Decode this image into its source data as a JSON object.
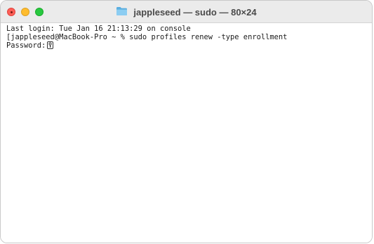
{
  "window": {
    "title": "jappleseed — sudo — 80×24",
    "title_icon": "folder-icon",
    "controls": [
      "close-button",
      "minimize-button",
      "zoom-button"
    ]
  },
  "terminal": {
    "lines": [
      "Last login: Tue Jan 16 21:13:29 on console",
      "[jappleseed@MacBook-Pro ~ % sudo profiles renew -type enrollment",
      "Password:"
    ],
    "cursor_icon": "key-icon"
  },
  "colors": {
    "close": "#ff5f57",
    "minimize": "#febc2e",
    "zoom": "#28c840",
    "titlebar": "#ebebeb",
    "folder": "#6cb8e6",
    "text": "#1a1a1a"
  }
}
